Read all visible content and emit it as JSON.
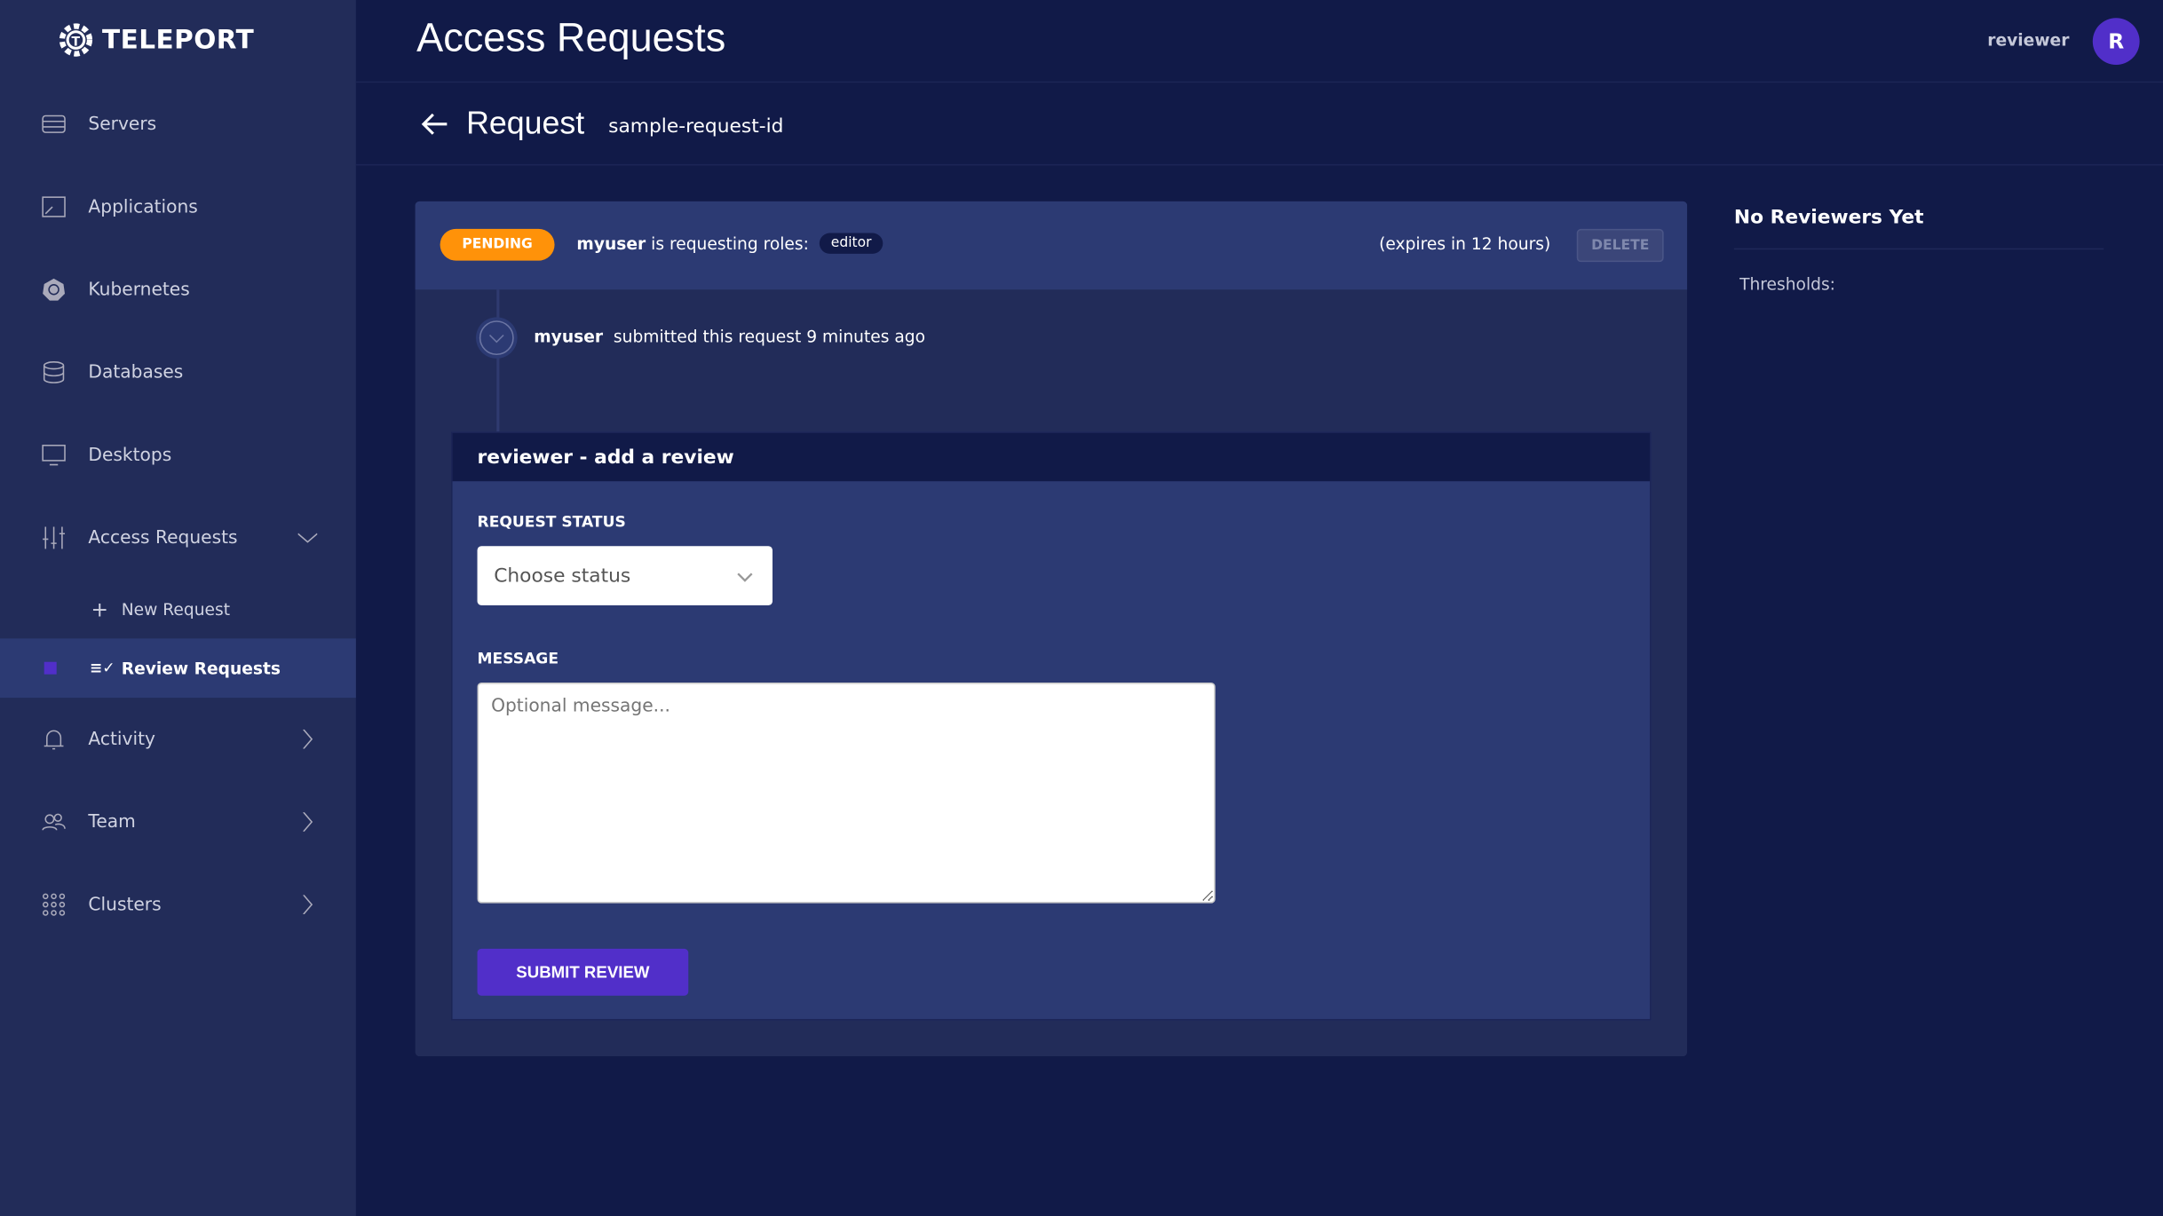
{
  "brand": "TELEPORT",
  "sidebar": {
    "items": [
      {
        "label": "Servers",
        "icon": "server-icon"
      },
      {
        "label": "Applications",
        "icon": "application-icon"
      },
      {
        "label": "Kubernetes",
        "icon": "kubernetes-icon"
      },
      {
        "label": "Databases",
        "icon": "database-icon"
      },
      {
        "label": "Desktops",
        "icon": "desktop-icon"
      },
      {
        "label": "Access Requests",
        "icon": "sliders-icon"
      },
      {
        "label": "Activity",
        "icon": "bell-icon"
      },
      {
        "label": "Team",
        "icon": "users-icon"
      },
      {
        "label": "Clusters",
        "icon": "grid-icon"
      }
    ],
    "sub_items": [
      {
        "label": "New Request"
      },
      {
        "label": "Review Requests",
        "active": true
      }
    ]
  },
  "header": {
    "title": "Access Requests",
    "username": "reviewer",
    "avatar_initial": "R"
  },
  "request": {
    "title": "Request",
    "id": "sample-request-id",
    "status": "PENDING",
    "user": "myuser",
    "requesting_text": "is requesting roles:",
    "role": "editor",
    "expires": "(expires in 12 hours)",
    "delete_label": "DELETE",
    "timeline": {
      "user": "myuser",
      "text": "submitted this request 9 minutes ago"
    }
  },
  "review": {
    "title": "reviewer - add a review",
    "status_label": "REQUEST STATUS",
    "status_placeholder": "Choose status",
    "message_label": "MESSAGE",
    "message_placeholder": "Optional message...",
    "submit_label": "SUBMIT REVIEW"
  },
  "reviewers": {
    "title": "No Reviewers Yet",
    "thresholds_label": "Thresholds:"
  },
  "colors": {
    "accent": "#512fc9",
    "pending": "#ff9209",
    "sidebar": "#222c59",
    "background": "#111a48"
  }
}
